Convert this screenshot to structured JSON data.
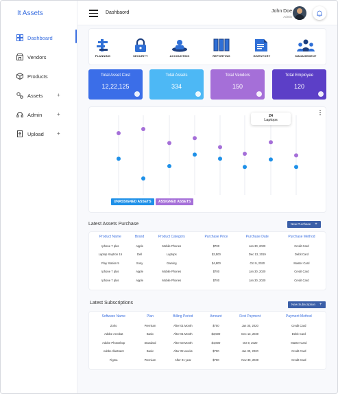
{
  "app": {
    "title": "It Assets"
  },
  "sidebar": {
    "items": [
      {
        "label": "Dashboard",
        "icon": "dashboard-icon",
        "active": true
      },
      {
        "label": "Vendors",
        "icon": "vendors-icon"
      },
      {
        "label": "Products",
        "icon": "box-icon"
      },
      {
        "label": "Assets",
        "icon": "assets-icon",
        "expand": "+"
      },
      {
        "label": "Admin",
        "icon": "headset-icon",
        "expand": "+"
      },
      {
        "label": "Upload",
        "icon": "upload-icon",
        "expand": "+"
      }
    ]
  },
  "header": {
    "title": "Dashbaord",
    "user_name": "John Doe",
    "user_role": "Admin"
  },
  "categories": [
    {
      "label": "PLANNING",
      "icon": "planning-icon"
    },
    {
      "label": "SECURITY",
      "icon": "lock-icon"
    },
    {
      "label": "ACCOUNTING",
      "icon": "accounting-icon"
    },
    {
      "label": "REPORTING",
      "icon": "reporting-icon"
    },
    {
      "label": "INVENTORY",
      "icon": "inventory-icon"
    },
    {
      "label": "MANAGEMENT",
      "icon": "management-icon"
    }
  ],
  "stats": [
    {
      "title": "Total Asset Cost",
      "value": "12,22,125",
      "color": "#3b6ee8"
    },
    {
      "title": "Total Assets",
      "value": "334",
      "color": "#4db8f5"
    },
    {
      "title": "Total Vendors",
      "value": "150",
      "color": "#a56fd8"
    },
    {
      "title": "Total Employee",
      "value": "120",
      "color": "#5c3fc7"
    }
  ],
  "chart_data": {
    "type": "scatter",
    "series": [
      {
        "name": "ASSIGNED ASSETS",
        "color": "#a56fd8",
        "values": [
          75,
          80,
          63,
          69,
          58,
          50,
          64,
          48
        ]
      },
      {
        "name": "UNASSIGNED ASSETS",
        "color": "#1e90e8",
        "values": [
          44,
          20,
          35,
          49,
          44,
          34,
          43,
          34
        ]
      }
    ],
    "ylim": [
      0,
      100
    ],
    "tooltip": {
      "value": "24",
      "label": "Laptops"
    }
  },
  "purchases": {
    "title": "Latest Assets Purchase",
    "button": "New Purchase",
    "columns": [
      "Product Name",
      "Brand",
      "Product Category",
      "Purchase Price",
      "Purchase Date",
      "Purchase Method"
    ],
    "rows": [
      [
        "Iphone 7 plus",
        "Apple",
        "Mobile Phones",
        "$700",
        "Jan 30, 2020",
        "Credit Card"
      ],
      [
        "Laptop Xeptron 15",
        "Dell",
        "Laptops",
        "$3,500",
        "Dec 13, 2019",
        "Debit Card"
      ],
      [
        "Play Station 5",
        "Sony",
        "Gaming",
        "$4,800",
        "Oct 9, 2020",
        "Master Card"
      ],
      [
        "Iphone 7 plus",
        "Apple",
        "Mobile Phones",
        "$700",
        "Jan 30, 2020",
        "Credit Card"
      ],
      [
        "Iphone 7 plus",
        "Apple",
        "Mobile Phones",
        "$700",
        "Jan 30, 2020",
        "Credit Card"
      ]
    ]
  },
  "subscriptions": {
    "title": "Latest Subscriptions",
    "button": "New Subscription",
    "columns": [
      "Software Name",
      "Plan",
      "Billing Period",
      "Amount",
      "First Payment",
      "Payment Method"
    ],
    "rows": [
      [
        "Zoho",
        "Premium",
        "After 01 Month",
        "$700",
        "Jan 30, 2020",
        "Credit Card"
      ],
      [
        "Adobe Acrobat",
        "Basic",
        "After 01 Month",
        "$3,500",
        "Dec 13, 2020",
        "Debit Card"
      ],
      [
        "Adobe Photoshop",
        "Standard",
        "After 03 Month",
        "$4,800",
        "Oct 9, 2020",
        "Master Card"
      ],
      [
        "Adobe Illustrator",
        "Basic",
        "After 02 weeks",
        "$700",
        "Jan 30, 2020",
        "Credit Card"
      ],
      [
        "Figma",
        "Premium",
        "After 01 year",
        "$700",
        "Nov 30, 2020",
        "Credit Card"
      ]
    ]
  }
}
